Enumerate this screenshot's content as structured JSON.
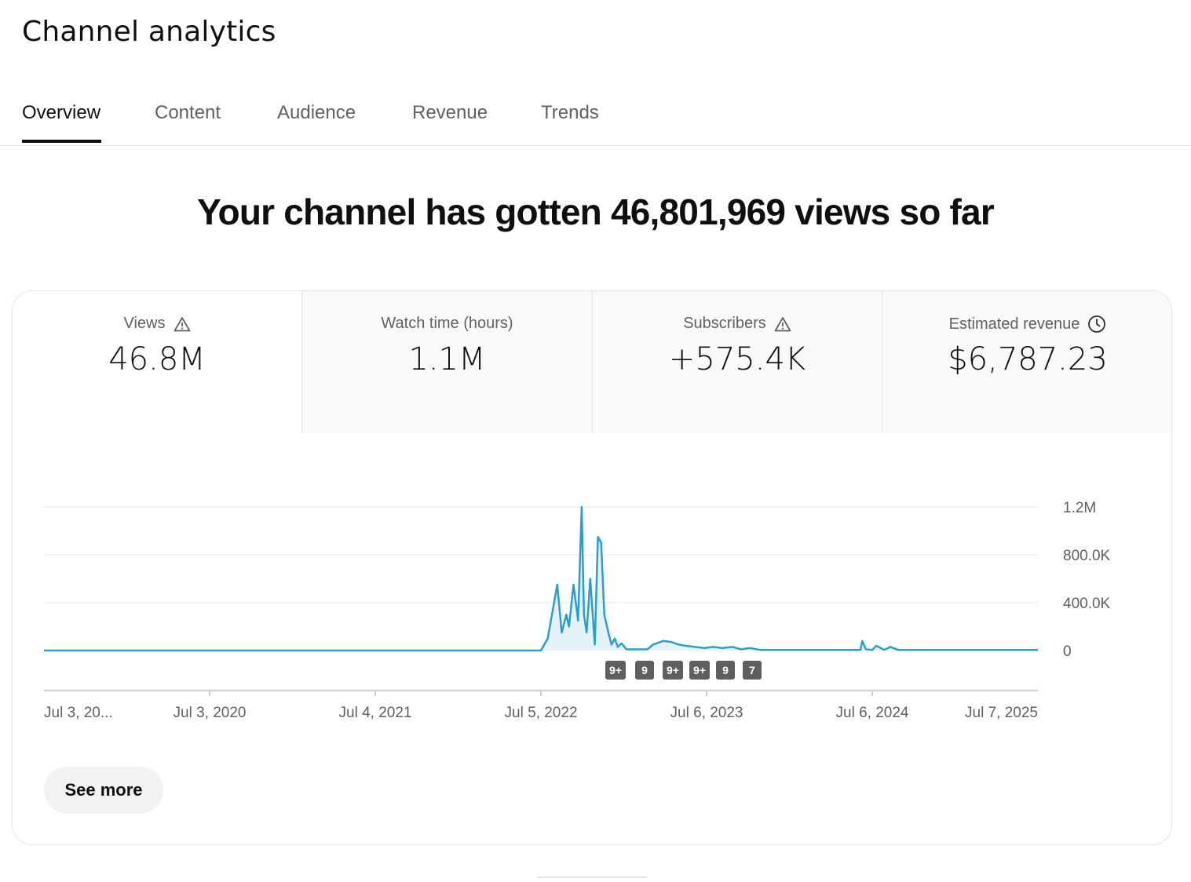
{
  "page": {
    "title": "Channel analytics"
  },
  "tabs": [
    {
      "label": "Overview",
      "active": true
    },
    {
      "label": "Content",
      "active": false
    },
    {
      "label": "Audience",
      "active": false
    },
    {
      "label": "Revenue",
      "active": false
    },
    {
      "label": "Trends",
      "active": false
    }
  ],
  "headline": "Your channel has gotten 46,801,969 views so far",
  "metrics": [
    {
      "label": "Views",
      "value": "46.8M",
      "icon": "warning-icon"
    },
    {
      "label": "Watch time (hours)",
      "value": "1.1M",
      "icon": ""
    },
    {
      "label": "Subscribers",
      "value": "+575.4K",
      "icon": "warning-icon"
    },
    {
      "label": "Estimated revenue",
      "value": "$6,787.23",
      "icon": "clock-icon"
    }
  ],
  "chart_data": {
    "type": "line",
    "series": [
      {
        "color": "#2a9fc9",
        "x": [
          "2019-07-03",
          "2022-07-05",
          "2022-07-20",
          "2022-08-10",
          "2022-08-20",
          "2022-08-30",
          "2022-09-05",
          "2022-09-15",
          "2022-09-25",
          "2022-10-03",
          "2022-10-08",
          "2022-10-14",
          "2022-10-22",
          "2022-11-01",
          "2022-11-08",
          "2022-11-15",
          "2022-11-22",
          "2022-12-01",
          "2022-12-08",
          "2022-12-15",
          "2022-12-22",
          "2022-12-30",
          "2023-01-10",
          "2023-01-25",
          "2023-02-10",
          "2023-02-25",
          "2023-03-10",
          "2023-04-01",
          "2023-04-20",
          "2023-05-05",
          "2023-05-20",
          "2023-06-10",
          "2023-07-01",
          "2023-07-20",
          "2023-08-10",
          "2023-09-01",
          "2023-09-20",
          "2023-10-10",
          "2023-11-01",
          "2024-02-01",
          "2024-05-01",
          "2024-06-10",
          "2024-06-14",
          "2024-06-22",
          "2024-07-06",
          "2024-07-15",
          "2024-08-01",
          "2024-08-15",
          "2024-09-01",
          "2025-07-07"
        ],
        "values": [
          0,
          0,
          100000,
          550000,
          150000,
          300000,
          200000,
          550000,
          250000,
          1200000,
          300000,
          150000,
          600000,
          50000,
          950000,
          900000,
          300000,
          150000,
          50000,
          100000,
          30000,
          60000,
          10000,
          10000,
          10000,
          10000,
          50000,
          80000,
          70000,
          50000,
          40000,
          30000,
          20000,
          30000,
          20000,
          30000,
          10000,
          20000,
          5000,
          5000,
          5000,
          5000,
          80000,
          10000,
          5000,
          40000,
          5000,
          30000,
          5000,
          5000
        ]
      }
    ],
    "x_tick_labels": [
      "Jul 3, 20...",
      "Jul 3, 2020",
      "Jul 4, 2021",
      "Jul 5, 2022",
      "Jul 6, 2023",
      "Jul 6, 2024",
      "Jul 7, 2025"
    ],
    "y_tick_labels": [
      "0",
      "400.0K",
      "800.0K",
      "1.2M"
    ],
    "y_ticks": [
      0,
      400000,
      800000,
      1200000
    ],
    "ylim": [
      0,
      1200000
    ],
    "xlim": [
      "2019-07-03",
      "2025-07-07"
    ],
    "annotations": [
      "9+",
      "9",
      "9+",
      "9+",
      "9",
      "7"
    ],
    "grid": true
  },
  "see_more_label": "See more"
}
